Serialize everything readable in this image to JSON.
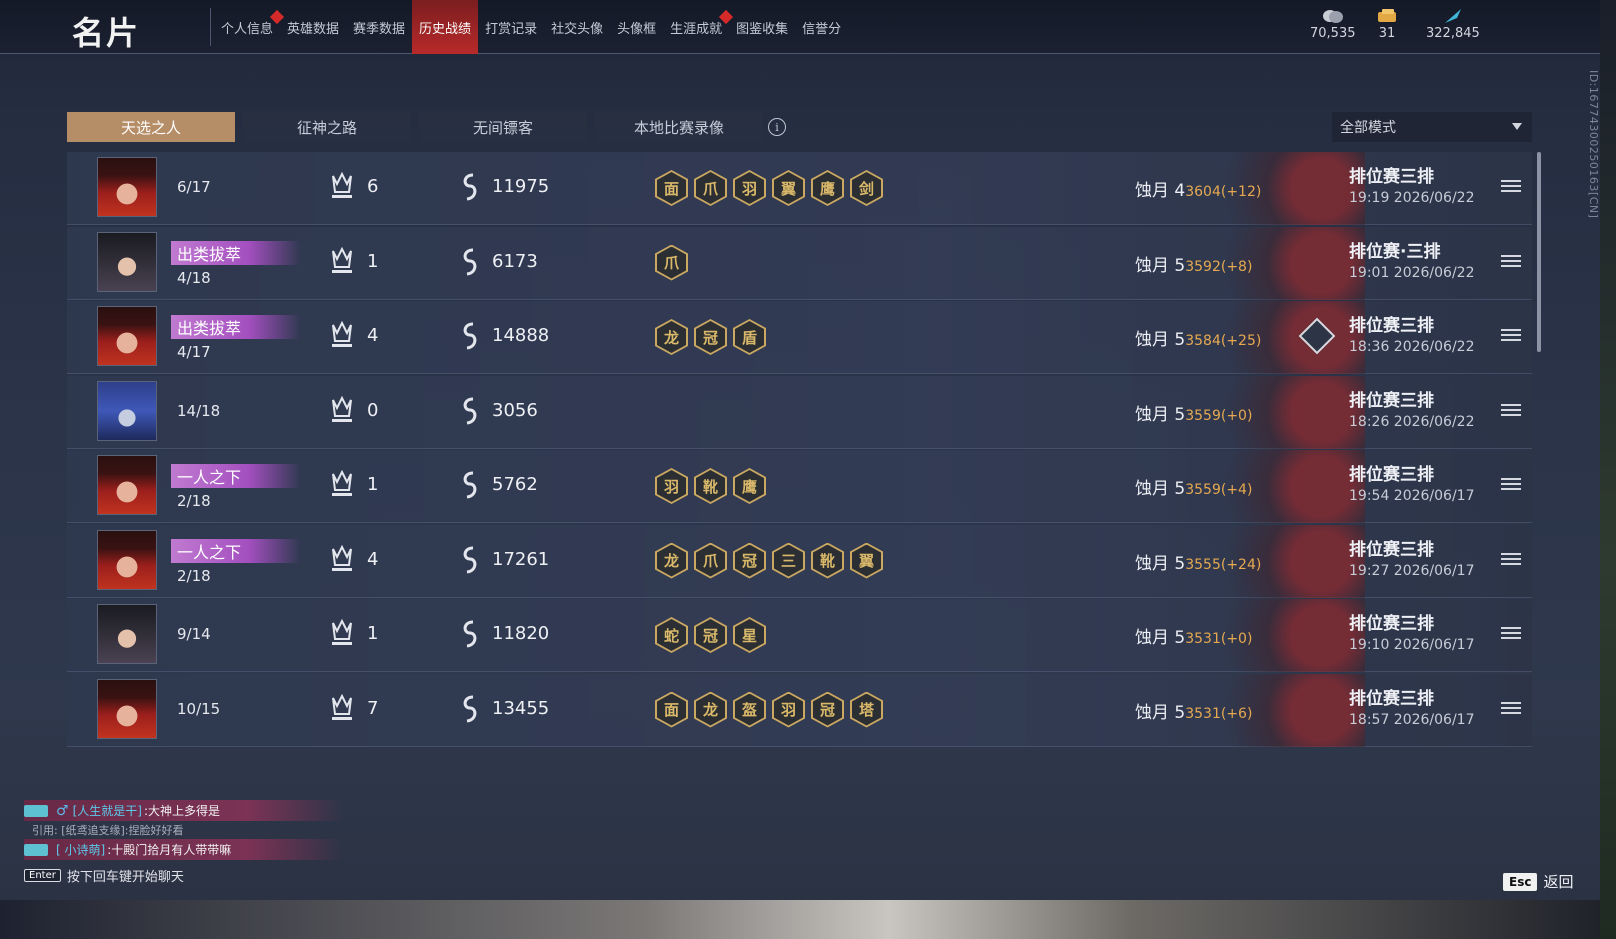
{
  "header": {
    "title": "名片",
    "nav": [
      {
        "label": "个人信息",
        "dot": true
      },
      {
        "label": "英雄数据",
        "dot": false
      },
      {
        "label": "赛季数据",
        "dot": false
      },
      {
        "label": "历史战绩",
        "dot": false,
        "active": true
      },
      {
        "label": "打赏记录",
        "dot": false
      },
      {
        "label": "社交头像",
        "dot": false
      },
      {
        "label": "头像框",
        "dot": false
      },
      {
        "label": "生涯成就",
        "dot": true
      },
      {
        "label": "图鉴收集",
        "dot": false
      },
      {
        "label": "信誉分",
        "dot": false
      }
    ],
    "currencies": [
      {
        "icon": "coin-stack-icon",
        "value": "70,535"
      },
      {
        "icon": "ticket-icon",
        "value": "31"
      },
      {
        "icon": "feather-icon",
        "value": "322,845"
      }
    ]
  },
  "filters": {
    "tabs": [
      "天选之人",
      "征神之路",
      "无间镖客",
      "本地比赛录像"
    ],
    "active_tab": 0,
    "mode_select": "全部模式"
  },
  "side_id": "ID:16774300250163[CN]",
  "matches": [
    {
      "avatar": "red",
      "title": "",
      "rank": "6/17",
      "kills": "6",
      "score": "11975",
      "badges": [
        "面",
        "爪",
        "羽",
        "翼",
        "鹰",
        "剑"
      ],
      "tier": "蚀月 4",
      "points": "3604(+12)",
      "mode": "排位赛三排",
      "time": "19:19  2026/06/22",
      "mvp": false
    },
    {
      "avatar": "dark",
      "title": "出类拔萃",
      "rank": "4/18",
      "kills": "1",
      "score": "6173",
      "badges": [
        "爪"
      ],
      "tier": "蚀月 5",
      "points": "3592(+8)",
      "mode": "排位赛·三排",
      "time": "19:01  2026/06/22",
      "mvp": false
    },
    {
      "avatar": "red",
      "title": "出类拔萃",
      "rank": "4/17",
      "kills": "4",
      "score": "14888",
      "badges": [
        "龙",
        "冠",
        "盾"
      ],
      "tier": "蚀月 5",
      "points": "3584(+25)",
      "mode": "排位赛三排",
      "time": "18:36  2026/06/22",
      "mvp": true
    },
    {
      "avatar": "blue",
      "title": "",
      "rank": "14/18",
      "kills": "0",
      "score": "3056",
      "badges": [],
      "tier": "蚀月 5",
      "points": "3559(+0)",
      "mode": "排位赛三排",
      "time": "18:26  2026/06/22",
      "mvp": false
    },
    {
      "avatar": "red",
      "title": "一人之下",
      "rank": "2/18",
      "kills": "1",
      "score": "5762",
      "badges": [
        "羽",
        "靴",
        "鹰"
      ],
      "tier": "蚀月 5",
      "points": "3559(+4)",
      "mode": "排位赛三排",
      "time": "19:54  2026/06/17",
      "mvp": false
    },
    {
      "avatar": "red",
      "title": "一人之下",
      "rank": "2/18",
      "kills": "4",
      "score": "17261",
      "badges": [
        "龙",
        "爪",
        "冠",
        "三",
        "靴",
        "翼"
      ],
      "tier": "蚀月 5",
      "points": "3555(+24)",
      "mode": "排位赛三排",
      "time": "19:27  2026/06/17",
      "mvp": false
    },
    {
      "avatar": "dark",
      "title": "",
      "rank": "9/14",
      "kills": "1",
      "score": "11820",
      "badges": [
        "蛇",
        "冠",
        "星"
      ],
      "tier": "蚀月 5",
      "points": "3531(+0)",
      "mode": "排位赛三排",
      "time": "19:10  2026/06/17",
      "mvp": false
    },
    {
      "avatar": "red",
      "title": "",
      "rank": "10/15",
      "kills": "7",
      "score": "13455",
      "badges": [
        "面",
        "龙",
        "盔",
        "羽",
        "冠",
        "塔"
      ],
      "tier": "蚀月 5",
      "points": "3531(+6)",
      "mode": "排位赛三排",
      "time": "18:57  2026/06/17",
      "mvp": false
    }
  ],
  "chat": {
    "line1_name": "[人生就是干]",
    "line1_text": ":大神上多得是",
    "line1_quote": "引用: [纸鸢追支缘]:捏脸好好看",
    "line2_name": "[ 小诗萌]",
    "line2_text": ":十殿门拾月有人带带嘛",
    "enter_key": "Enter",
    "hint": "按下回车键开始聊天"
  },
  "footer": {
    "esc_key": "Esc",
    "back_label": "返回"
  },
  "colors": {
    "accent_tab": "#b58d67",
    "nav_active": "#b82a2a",
    "title_badge": "#a34fbf",
    "points": "#e6a951"
  }
}
